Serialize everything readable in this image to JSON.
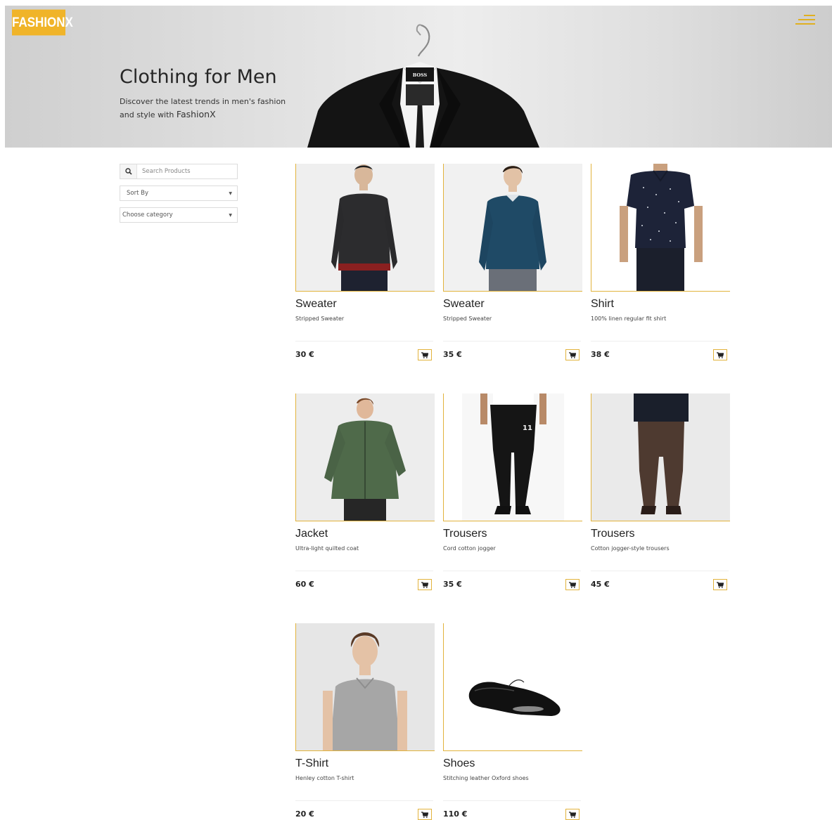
{
  "brand": {
    "logo_text": "FASHIONX",
    "accent_color": "#f0b429"
  },
  "header": {
    "menu_icon": "hamburger-menu-icon"
  },
  "hero": {
    "title": "Clothing for Men",
    "subtitle_part1": "Discover the latest trends in men's fashion and style with ",
    "subtitle_brand": "FashionX"
  },
  "filters": {
    "search_placeholder": "Search Products",
    "search_icon": "search-icon",
    "sort_label": "Sort By",
    "category_label": "Choose category"
  },
  "products": [
    {
      "name": "Sweater",
      "description": "Stripped Sweater",
      "price": "30 €"
    },
    {
      "name": "Sweater",
      "description": "Stripped Sweater",
      "price": "35 €"
    },
    {
      "name": "Shirt",
      "description": "100% linen regular fit shirt",
      "price": "38 €"
    },
    {
      "name": "Jacket",
      "description": "Ultra-light quilted coat",
      "price": "60 €"
    },
    {
      "name": "Trousers",
      "description": "Cord cotton jogger",
      "price": "35 €"
    },
    {
      "name": "Trousers",
      "description": "Cotton jogger-style trousers",
      "price": "45 €"
    },
    {
      "name": "T-Shirt",
      "description": "Henley cotton T-shirt",
      "price": "20 €"
    },
    {
      "name": "Shoes",
      "description": "Stitching leather Oxford shoes",
      "price": "110 €"
    }
  ]
}
